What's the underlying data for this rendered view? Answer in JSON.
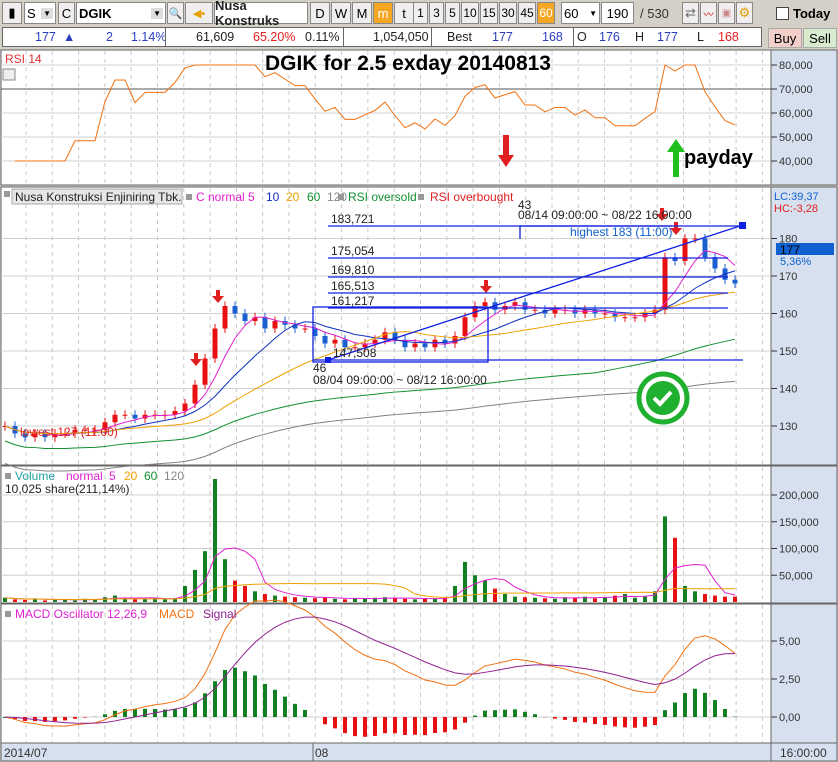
{
  "toolbar": {
    "market": "S",
    "type_btn": "C",
    "symbol": "DGIK",
    "company_short": "Nusa Konstruks",
    "periods": [
      "D",
      "W",
      "M",
      "m",
      "t"
    ],
    "active_period": "m",
    "intervals": [
      "1",
      "3",
      "5",
      "10",
      "15",
      "30",
      "45",
      "60"
    ],
    "active_interval": "60",
    "interval_select": "60",
    "count": "190",
    "total": "/ 530",
    "today_label": "Today"
  },
  "quote": {
    "price": "177",
    "change_arrow": "▲",
    "change": "2",
    "change_pct": "1.14%",
    "volume": "61,609",
    "vol_ratio": "65.20%",
    "turnover_pct": "0.11%",
    "value": "1,054,050",
    "best_label": "Best",
    "best_bid": "177",
    "best_ask": "168",
    "open_label": "O",
    "open": "176",
    "high_label": "H",
    "high": "177",
    "low_label": "L",
    "low": "168",
    "buy": "Buy",
    "sell": "Sell"
  },
  "annotations": {
    "title": "DGIK for 2.5 exday 20140813",
    "payday": "payday"
  },
  "rsi": {
    "label": "RSI 14",
    "axis": [
      "80,000",
      "70,000",
      "60,000",
      "50,000",
      "40,000"
    ]
  },
  "main": {
    "legend_name": "Nusa Konstruksi Enjiniring Tbk.",
    "legend_c": "C normal",
    "ma": [
      "5",
      "10",
      "20",
      "60",
      "120"
    ],
    "rsi_oversold": "RSI oversold",
    "rsi_overbought": "RSI overbought",
    "levels": [
      "183,721",
      "175,054",
      "169,810",
      "165,513",
      "161,217",
      "147,508"
    ],
    "range1_count": "46",
    "range1": "08/04 09:00:00 ~ 08/12 16:00:00",
    "range2_count": "43",
    "range2": "08/14 09:00:00 ~ 08/22 16:00:00",
    "highest": "highest 183 (11:00)",
    "lowest": "lowest 127 (11:00)",
    "axis": [
      "180",
      "170",
      "160",
      "150",
      "140",
      "130"
    ],
    "lc": "LC:39,37",
    "hc": "HC:-3,28",
    "last": "177",
    "last_pct": "5,36%"
  },
  "volume": {
    "label": "Volume",
    "legend_n": "normal",
    "ma": [
      "5",
      "20",
      "60",
      "120"
    ],
    "info": "10,025 share(211,14%)",
    "axis": [
      "200,000",
      "150,000",
      "100,000",
      "50,000"
    ]
  },
  "macd": {
    "label": "MACD Oscillator 12,26,9",
    "macd": "MACD",
    "signal": "Signal",
    "axis": [
      "5,00",
      "2,50",
      "0,00"
    ]
  },
  "xaxis": {
    "start": "2014/07",
    "mid": "08",
    "time": "16:00:00"
  },
  "colors": {
    "up": "#e81010",
    "down": "#1a5fd0",
    "ma5": "#e020d0",
    "ma10": "#1030c0",
    "ma20": "#f0a000",
    "ma60": "#109030",
    "ma120": "#808080",
    "rsi": "#f07010"
  },
  "chart_data": {
    "type": "candlestick",
    "close": [
      130,
      128,
      127,
      128,
      127,
      128,
      128,
      129,
      129,
      129,
      131,
      133,
      133,
      132,
      133,
      133,
      133,
      134,
      136,
      141,
      148,
      156,
      162,
      160,
      158,
      159,
      156,
      158,
      157,
      156,
      156,
      154,
      152,
      153,
      151,
      151,
      152,
      153,
      155,
      153,
      151,
      152,
      151,
      153,
      152,
      154,
      159,
      162,
      163,
      161,
      162,
      163,
      161,
      161,
      160,
      161,
      161,
      160,
      161,
      160,
      160,
      159,
      159,
      159,
      160,
      161,
      175,
      174,
      180,
      180,
      175,
      172,
      169,
      168
    ],
    "volume": [
      8000,
      5000,
      4000,
      6000,
      3000,
      4000,
      5000,
      3000,
      6000,
      4000,
      9000,
      12000,
      7000,
      5000,
      6000,
      8000,
      5000,
      7000,
      30000,
      60000,
      95000,
      230000,
      80000,
      40000,
      30000,
      20000,
      15000,
      12000,
      10000,
      9000,
      8000,
      7000,
      9000,
      6000,
      5000,
      7000,
      6000,
      8000,
      9000,
      7000,
      6000,
      5000,
      6000,
      7000,
      8000,
      30000,
      75000,
      50000,
      40000,
      25000,
      15000,
      10000,
      9000,
      8000,
      7000,
      6000,
      9000,
      8000,
      10000,
      7000,
      9000,
      12000,
      15000,
      8000,
      10000,
      20000,
      160000,
      120000,
      30000,
      20000,
      15000,
      12000,
      10000,
      10025
    ]
  }
}
